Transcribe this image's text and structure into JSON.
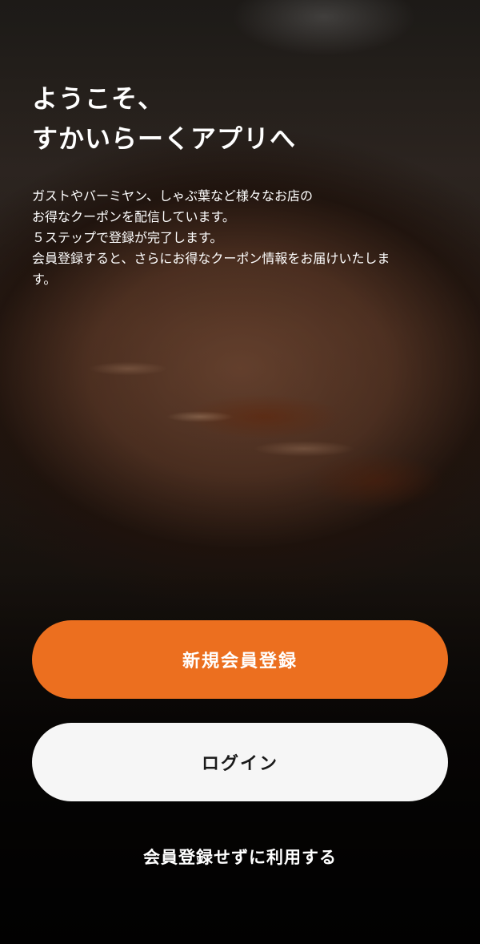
{
  "welcome": {
    "title_lines": [
      "ようこそ、",
      "すかいらーくアプリへ"
    ],
    "intro_lines": [
      "ガストやバーミヤン、しゃぶ葉など様々なお店の",
      "お得なクーポンを配信しています。",
      "５ステップで登録が完了します。",
      "会員登録すると、さらにお得なクーポン情報をお届けいたしま",
      "す。"
    ]
  },
  "actions": {
    "register_label": "新規会員登録",
    "login_label": "ログイン",
    "guest_label": "会員登録せずに利用する"
  },
  "colors": {
    "accent": "#ec6f1f",
    "login_button_bg": "#f6f6f6",
    "text_on_dark": "#ffffff"
  }
}
